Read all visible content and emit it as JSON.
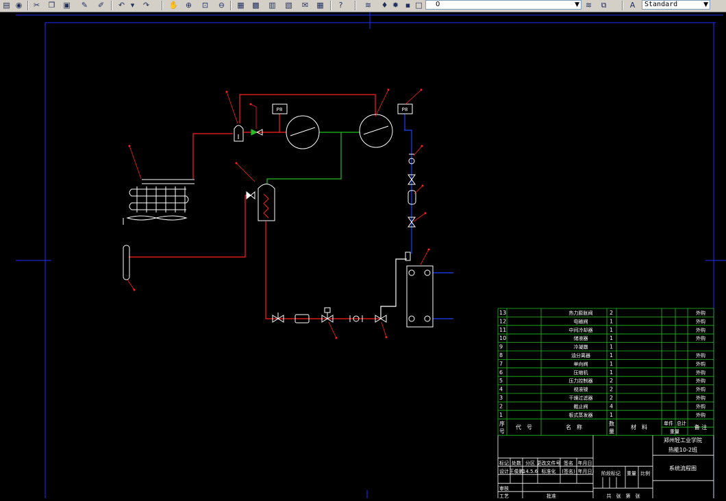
{
  "toolbar": {
    "layer_value": "0",
    "text_style_value": "Standard",
    "icons": [
      "open-icon",
      "save-icon",
      "cut-icon",
      "copy-icon",
      "paste-icon",
      "match-properties-icon",
      "brush-icon",
      "undo-icon",
      "redo-icon",
      "pan-icon",
      "zoom-realtime-icon",
      "zoom-window-icon",
      "zoom-previous-icon",
      "properties-icon",
      "design-center-icon",
      "tool-palettes-icon",
      "sheet-set-icon",
      "markup-icon",
      "calculator-icon",
      "help-icon",
      "layer-manager-icon",
      "layer-state-icon",
      "text-style-icon"
    ]
  },
  "drawing": {
    "colors": {
      "red": "#ff2020",
      "blue": "#2040ff",
      "green": "#20c020",
      "white": "#ffffff",
      "frame": "#2030ff"
    },
    "gauge_label": "P8",
    "part_numbers": [
      "1",
      "2",
      "3",
      "4",
      "5",
      "6",
      "7",
      "8",
      "9",
      "10",
      "11",
      "12",
      "13"
    ]
  },
  "parts_table": {
    "rows": [
      {
        "no": "13",
        "name": "热力膨胀阀",
        "qty": "2",
        "note": "外购"
      },
      {
        "no": "12",
        "name": "电磁阀",
        "qty": "1",
        "note": "外购"
      },
      {
        "no": "11",
        "name": "中间冷却器",
        "qty": "1",
        "note": "外购"
      },
      {
        "no": "10",
        "name": "储液器",
        "qty": "1",
        "note": "外购"
      },
      {
        "no": "9",
        "name": "冷凝器",
        "qty": "1",
        "note": ""
      },
      {
        "no": "8",
        "name": "油分离器",
        "qty": "1",
        "note": "外购"
      },
      {
        "no": "7",
        "name": "单向阀",
        "qty": "1",
        "note": "外购"
      },
      {
        "no": "6",
        "name": "压缩机",
        "qty": "1",
        "note": "外购"
      },
      {
        "no": "5",
        "name": "压力控制器",
        "qty": "2",
        "note": "外购"
      },
      {
        "no": "4",
        "name": "视液镜",
        "qty": "2",
        "note": "外购"
      },
      {
        "no": "3",
        "name": "干燥过滤器",
        "qty": "2",
        "note": "外购"
      },
      {
        "no": "2",
        "name": "截止阀",
        "qty": "4",
        "note": "外购"
      },
      {
        "no": "1",
        "name": "板式蒸发器",
        "qty": "1",
        "note": "外购"
      }
    ],
    "header": {
      "no_a": "序",
      "no_b": "号",
      "code": "代　号",
      "name": "名　称",
      "qty_a": "数",
      "qty_b": "量",
      "material": "材　料",
      "unit": "单件",
      "total": "总计",
      "weight": "重量",
      "remark": "备 注"
    },
    "school": "郑州轻工业学院",
    "class_name": "热能10-2班",
    "drawing_title": "系统流程图",
    "title_cells": {
      "mark": "标记",
      "count": "处数",
      "zone": "分区",
      "doc_no": "更改文件号",
      "sign": "签名",
      "date": "年月日",
      "design": "设计",
      "designer": "王俊鹏",
      "design_date": "14.5.6",
      "standardize": "标准化",
      "sign2": "(签名)",
      "date2": "(年月日)",
      "stage_mark": "阶段标记",
      "weight": "重量",
      "scale": "比例",
      "review": "审核",
      "process": "工艺",
      "approve": "批准",
      "sheets": "共　张　第　张"
    }
  }
}
